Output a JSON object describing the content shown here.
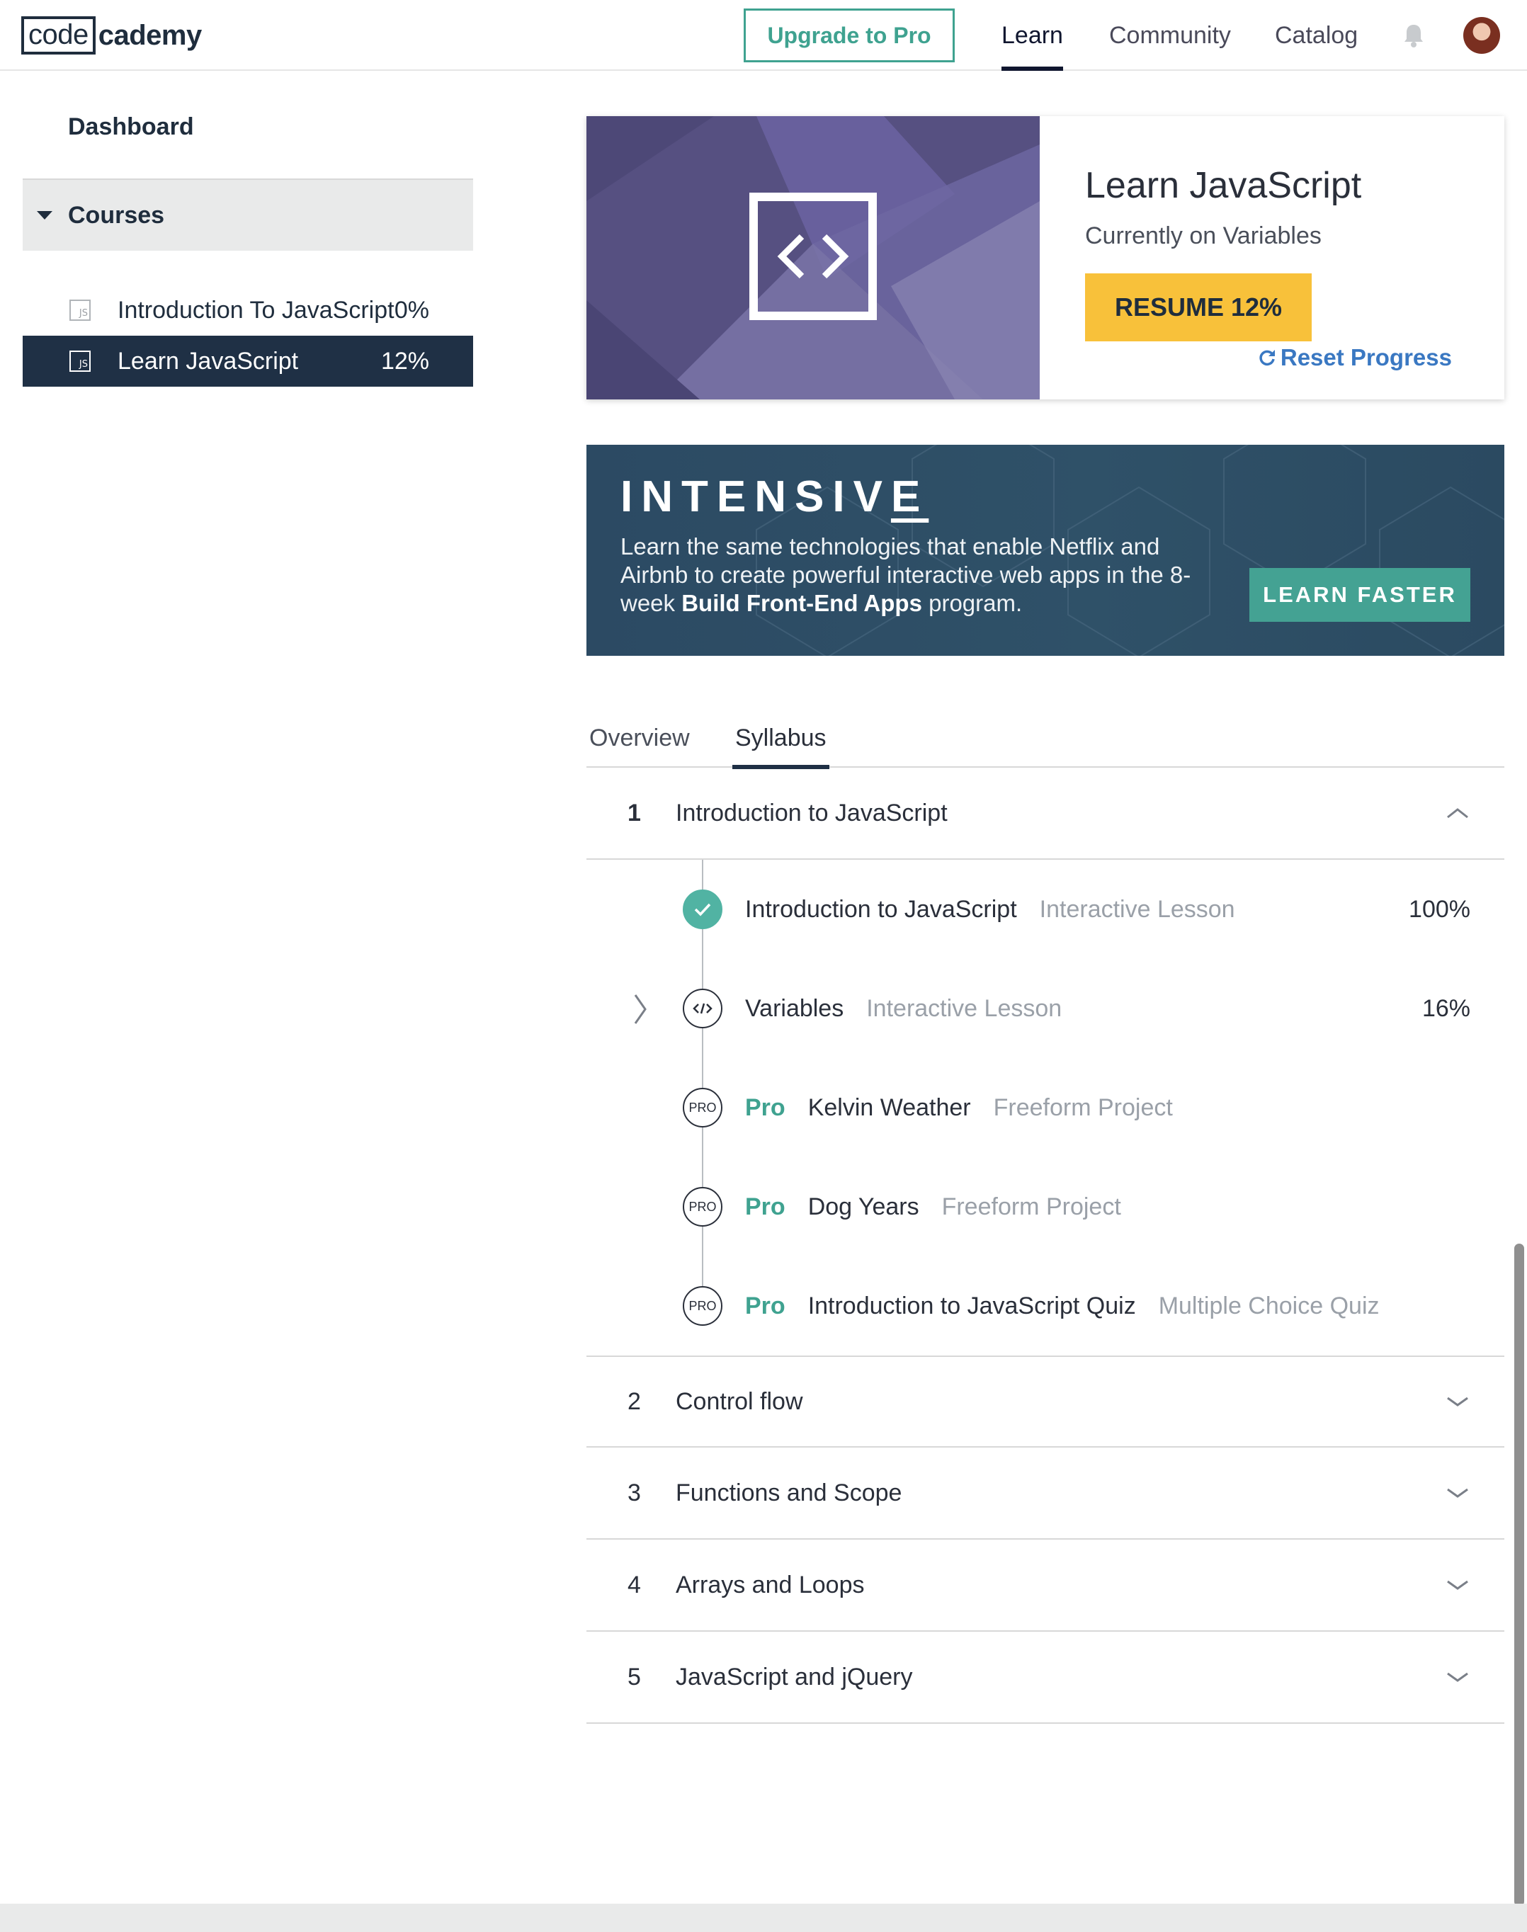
{
  "header": {
    "logo_code": "code",
    "logo_cademy": "cademy",
    "upgrade_label": "Upgrade to Pro",
    "nav": [
      {
        "label": "Learn",
        "active": true
      },
      {
        "label": "Community",
        "active": false
      },
      {
        "label": "Catalog",
        "active": false
      }
    ],
    "icons": [
      "bell-icon",
      "avatar"
    ]
  },
  "sidebar": {
    "dashboard_label": "Dashboard",
    "courses_label": "Courses",
    "items": [
      {
        "icon": "JS",
        "name": "Introduction To JavaScript",
        "percent": "0%",
        "active": false
      },
      {
        "icon": "JS",
        "name": "Learn JavaScript",
        "percent": "12%",
        "active": true
      }
    ]
  },
  "course_card": {
    "title": "Learn JavaScript",
    "subtitle": "Currently on Variables",
    "resume_label": "RESUME 12%",
    "reset_label": "Reset Progress"
  },
  "banner": {
    "title_main": "INTENSIV",
    "title_last": "E",
    "text_part1": "Learn the same technologies that enable Netflix and Airbnb to create powerful interactive web apps in the 8-week ",
    "text_bold": "Build Front-End Apps",
    "text_part2": " program.",
    "cta_label": "LEARN FASTER"
  },
  "tabs": [
    {
      "label": "Overview",
      "active": false
    },
    {
      "label": "Syllabus",
      "active": true
    }
  ],
  "syllabus": {
    "units": [
      {
        "number": "1",
        "title": "Introduction to JavaScript",
        "expanded": true
      },
      {
        "number": "2",
        "title": "Control flow",
        "expanded": false
      },
      {
        "number": "3",
        "title": "Functions and Scope",
        "expanded": false
      },
      {
        "number": "4",
        "title": "Arrays and Loops",
        "expanded": false
      },
      {
        "number": "5",
        "title": "JavaScript and jQuery",
        "expanded": false
      }
    ],
    "lessons": [
      {
        "pro": "",
        "name": "Introduction to JavaScript",
        "type": "Interactive Lesson",
        "percent": "100%",
        "status": "complete"
      },
      {
        "pro": "",
        "name": "Variables",
        "type": "Interactive Lesson",
        "percent": "16%",
        "status": "in-progress"
      },
      {
        "pro": "Pro",
        "name": "Kelvin Weather",
        "type": "Freeform Project",
        "percent": "",
        "badge": "PRO"
      },
      {
        "pro": "Pro",
        "name": "Dog Years",
        "type": "Freeform Project",
        "percent": "",
        "badge": "PRO"
      },
      {
        "pro": "Pro",
        "name": "Introduction to JavaScript Quiz",
        "type": "Multiple Choice Quiz",
        "percent": "",
        "badge": "PRO"
      }
    ]
  },
  "colors": {
    "accent_teal": "#3fa290",
    "resume_yellow": "#f8c13a",
    "navy": "#1f3045",
    "link_blue": "#3a78c2"
  }
}
